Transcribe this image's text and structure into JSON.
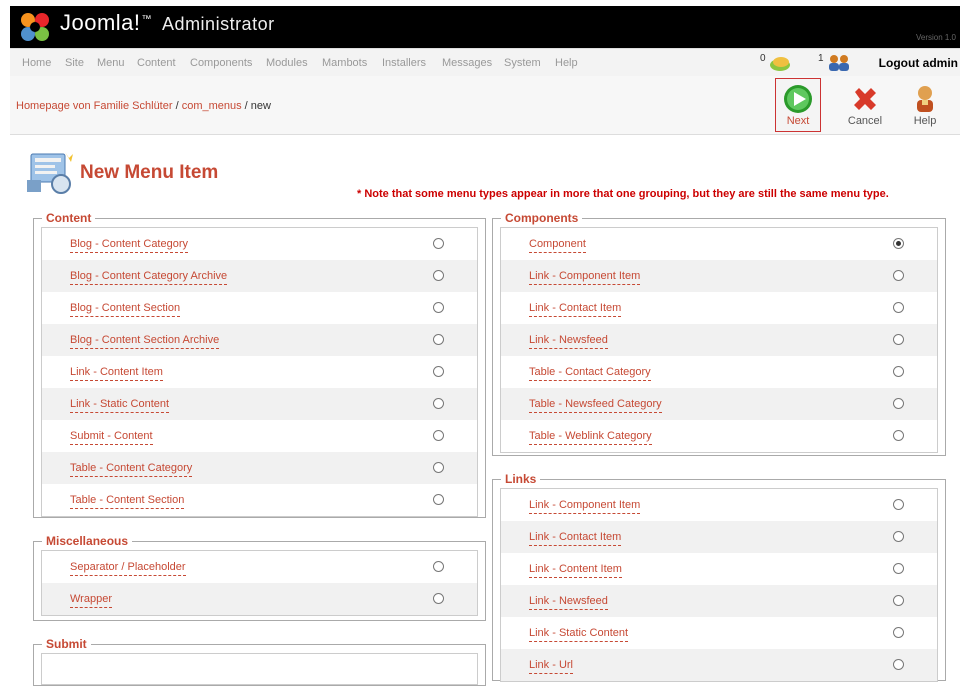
{
  "header": {
    "brand": "Joomla!",
    "tm": "™",
    "admin": "Administrator",
    "version": "Version 1.0"
  },
  "menubar": {
    "items": [
      "Home",
      "Site",
      "Menu",
      "Content",
      "Components",
      "Modules",
      "Mambots",
      "Installers",
      "Messages",
      "System",
      "Help"
    ],
    "messages_count": "0",
    "users_count": "1",
    "logout": "Logout admin"
  },
  "pathbar": {
    "site": "Homepage von Familie Schlüter",
    "sep": " / ",
    "component": "com_menus",
    "current": "new"
  },
  "toolbar": {
    "next": "Next",
    "cancel": "Cancel",
    "help": "Help"
  },
  "page": {
    "title": "New Menu Item",
    "note": "* Note that some menu types appear in more that one grouping, but they are still the same menu type."
  },
  "groups": {
    "content": {
      "legend": "Content",
      "items": [
        "Blog - Content Category",
        "Blog - Content Category Archive",
        "Blog - Content Section",
        "Blog - Content Section Archive",
        "Link - Content Item",
        "Link - Static Content",
        "Submit - Content",
        "Table - Content Category",
        "Table - Content Section"
      ]
    },
    "misc": {
      "legend": "Miscellaneous",
      "items": [
        "Separator / Placeholder",
        "Wrapper"
      ]
    },
    "submit": {
      "legend": "Submit"
    },
    "components": {
      "legend": "Components",
      "selected": "Component",
      "items": [
        "Component",
        "Link - Component Item",
        "Link - Contact Item",
        "Link - Newsfeed",
        "Table - Contact Category",
        "Table - Newsfeed Category",
        "Table - Weblink Category"
      ]
    },
    "links": {
      "legend": "Links",
      "items": [
        "Link - Component Item",
        "Link - Contact Item",
        "Link - Content Item",
        "Link - Newsfeed",
        "Link - Static Content",
        "Link - Url"
      ]
    }
  },
  "colors": {
    "accent": "#c64934",
    "note": "#cc0000",
    "next_green": "#2a9a2a",
    "cancel_red": "#d83a2a"
  }
}
